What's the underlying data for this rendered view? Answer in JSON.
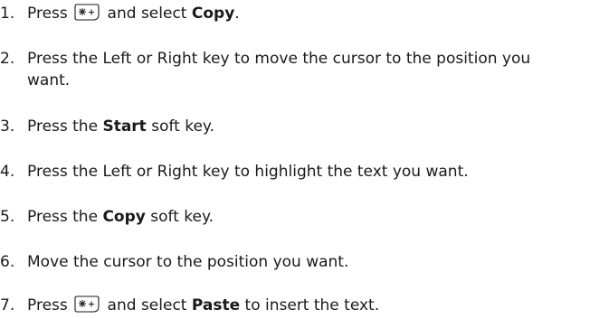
{
  "steps": [
    {
      "number": "1.",
      "parts": [
        "Press ",
        "",
        " and select ",
        "Copy",
        "."
      ]
    },
    {
      "number": "2.",
      "parts": [
        "Press the Left or Right key to move the cursor to the position you want."
      ]
    },
    {
      "number": "3.",
      "parts": [
        "Press the ",
        "Start",
        " soft key."
      ]
    },
    {
      "number": "4.",
      "parts": [
        "Press the Left or Right key to highlight the text you want."
      ]
    },
    {
      "number": "5.",
      "parts": [
        "Press the ",
        "Copy",
        " soft key."
      ]
    },
    {
      "number": "6.",
      "parts": [
        "Move the cursor to the position you want."
      ]
    },
    {
      "number": "7.",
      "parts": [
        "Press ",
        "",
        " and select ",
        "Paste",
        " to insert the text."
      ]
    }
  ],
  "icons": {
    "star_key": "star-plus-key-icon"
  }
}
